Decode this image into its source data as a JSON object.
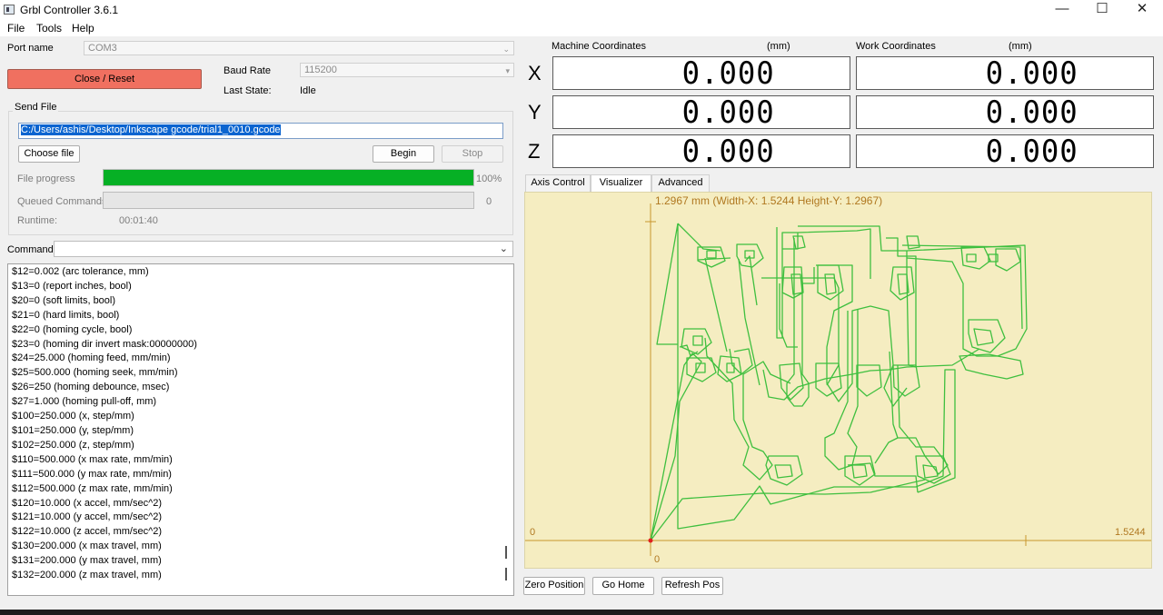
{
  "window": {
    "title": "Grbl Controller 3.6.1",
    "controls": [
      "—",
      "☐",
      "✕"
    ]
  },
  "menu": [
    "File",
    "Tools",
    "Help"
  ],
  "connection": {
    "port_label": "Port name",
    "port_value": "COM3",
    "baud_label": "Baud Rate",
    "baud_value": "115200",
    "state_label": "Last State:",
    "state_value": "Idle",
    "close_reset": "Close / Reset"
  },
  "send_file": {
    "legend": "Send File",
    "path": "C:/Users/ashis/Desktop/Inkscape gcode/trial1_0010.gcode",
    "choose": "Choose file",
    "begin": "Begin",
    "stop": "Stop",
    "progress_label": "File progress",
    "progress_value": 100,
    "progress_text": "100%",
    "queued_label": "Queued Commands",
    "queued_value": "0",
    "runtime_label": "Runtime:",
    "runtime_value": "00:01:40",
    "progress_color": "#06b025"
  },
  "command": {
    "label": "Command",
    "value": ""
  },
  "console_lines": [
    "$12=0.002 (arc tolerance, mm)",
    "$13=0 (report inches, bool)",
    "$20=0 (soft limits, bool)",
    "$21=0 (hard limits, bool)",
    "$22=0 (homing cycle, bool)",
    "$23=0 (homing dir invert mask:00000000)",
    "$24=25.000 (homing feed, mm/min)",
    "$25=500.000 (homing seek, mm/min)",
    "$26=250 (homing debounce, msec)",
    "$27=1.000 (homing pull-off, mm)",
    "$100=250.000 (x, step/mm)",
    "$101=250.000 (y, step/mm)",
    "$102=250.000 (z, step/mm)",
    "$110=500.000 (x max rate, mm/min)",
    "$111=500.000 (y max rate, mm/min)",
    "$112=500.000 (z max rate, mm/min)",
    "$120=10.000 (x accel, mm/sec^2)",
    "$121=10.000 (y accel, mm/sec^2)",
    "$122=10.000 (z accel, mm/sec^2)",
    "$130=200.000 (x max travel, mm)",
    "$131=200.000 (y max travel, mm)",
    "$132=200.000 (z max travel, mm)"
  ],
  "coords": {
    "machine_label": "Machine Coordinates",
    "work_label": "Work Coordinates",
    "unit": "(mm)",
    "axes": [
      {
        "name": "X",
        "machine": "0.000",
        "work": "0.000"
      },
      {
        "name": "Y",
        "machine": "0.000",
        "work": "0.000"
      },
      {
        "name": "Z",
        "machine": "0.000",
        "work": "0.000"
      }
    ]
  },
  "tabs": [
    "Axis Control",
    "Visualizer",
    "Advanced"
  ],
  "active_tab": "Visualizer",
  "visualizer": {
    "header": "1.2967 mm  (Width-X: 1.5244  Height-Y: 1.2967)",
    "x_max": "1.5244",
    "x_origin": "0",
    "y_origin": "0",
    "path_color": "#3fbf3f",
    "axis_color": "#c8962d",
    "origin_color": "#e02020"
  },
  "buttons": [
    "Zero Position",
    "Go Home",
    "Refresh Pos"
  ]
}
